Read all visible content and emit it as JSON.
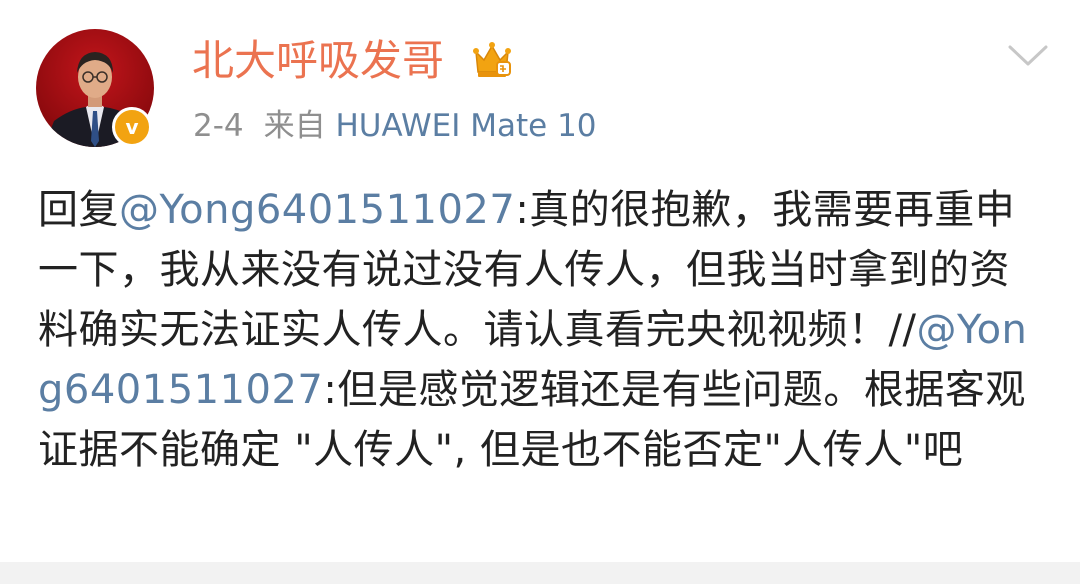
{
  "post": {
    "author": {
      "name": "北大呼吸发哥",
      "verified_badge_glyph": "v",
      "crown_icon": "crown-icon",
      "avatar_icon": "avatar-photo"
    },
    "meta": {
      "date": "2-4",
      "source_prefix": "来自",
      "source_device": "HUAWEI Mate 10"
    },
    "menu_icon": "chevron-down-icon",
    "content": {
      "reply_prefix": "回复",
      "mention_1": "@Yong6401511027",
      "text_1": ":真的很抱歉，我需要再重申一下，我从来没有说过没有人传人，但我当时拿到的资料确实无法证实人传人。请认真看完央视视频！//",
      "mention_2": "@Yong6401511027",
      "text_2": ":但是感觉逻辑还是有些问题。根据客观证据不能确定 \"人传人\", 但是也不能否定\"人传人\"吧"
    }
  },
  "colors": {
    "username": "#eb7350",
    "link": "#5b7ea3",
    "meta_gray": "#8f8f8f",
    "text": "#222222",
    "badge": "#f2a311"
  }
}
